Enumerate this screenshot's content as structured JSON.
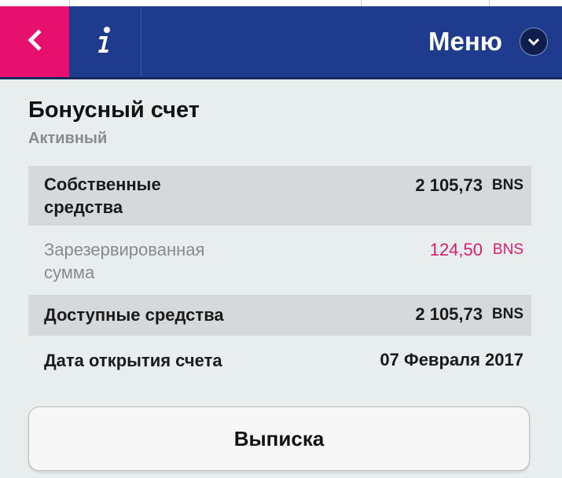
{
  "header": {
    "back_icon": "chevron-left-icon",
    "info_icon": "info-icon",
    "menu_label": "Меню",
    "menu_icon": "chevron-down-icon",
    "colors": {
      "navbar": "#1e3b8e",
      "back_button": "#e8106e"
    }
  },
  "account": {
    "title": "Бонусный счет",
    "status": "Активный",
    "rows": [
      {
        "label": "Собственные средства",
        "value": "2 105,73",
        "unit": "BNS"
      },
      {
        "label": "Зарезервированная сумма",
        "value": "124,50",
        "unit": "BNS"
      },
      {
        "label": "Доступные средства",
        "value": "2 105,73",
        "unit": "BNS"
      },
      {
        "label": "Дата открытия счета",
        "value": "07 Февраля 2017"
      }
    ]
  },
  "actions": {
    "statement_label": "Выписка"
  },
  "colors": {
    "accent_pink": "#d71d6f",
    "background": "#e8eeee",
    "row_shade": "#d5d9db"
  }
}
